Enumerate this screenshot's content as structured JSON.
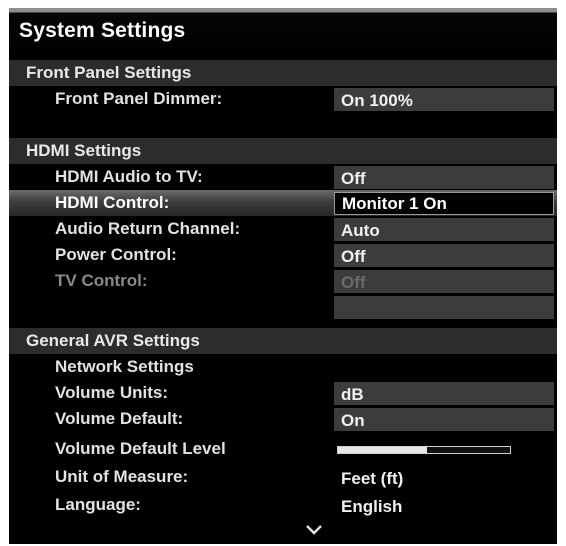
{
  "title": "System Settings",
  "groups": {
    "front_panel": "Front Panel Settings",
    "hdmi": "HDMI Settings",
    "general": "General AVR Settings"
  },
  "front_panel": {
    "dimmer": {
      "label": "Front Panel Dimmer:",
      "value": "On 100%"
    }
  },
  "hdmi": {
    "audio_to_tv": {
      "label": "HDMI Audio to TV:",
      "value": "Off"
    },
    "control": {
      "label": "HDMI Control:",
      "value": "Monitor 1 On"
    },
    "arc": {
      "label": "Audio Return Channel:",
      "value": "Auto"
    },
    "power": {
      "label": "Power Control:",
      "value": "Off"
    },
    "tv_control": {
      "label": "TV Control:",
      "value": "Off"
    }
  },
  "general": {
    "network": {
      "label": "Network Settings"
    },
    "volume_units": {
      "label": "Volume Units:",
      "value": "dB"
    },
    "volume_default": {
      "label": "Volume Default:",
      "value": "On"
    },
    "volume_default_level": {
      "label": "Volume Default Level",
      "level_fraction": 0.52
    },
    "unit_of_measure": {
      "label": "Unit of Measure:",
      "value": "Feet (ft)"
    },
    "language": {
      "label": "Language:",
      "value": "English"
    }
  },
  "icons": {
    "scroll_down": "chevron-down-icon"
  },
  "colors": {
    "background": "#000000",
    "highlight": "#6b6b6b",
    "value_box": "#3c3c3c"
  }
}
